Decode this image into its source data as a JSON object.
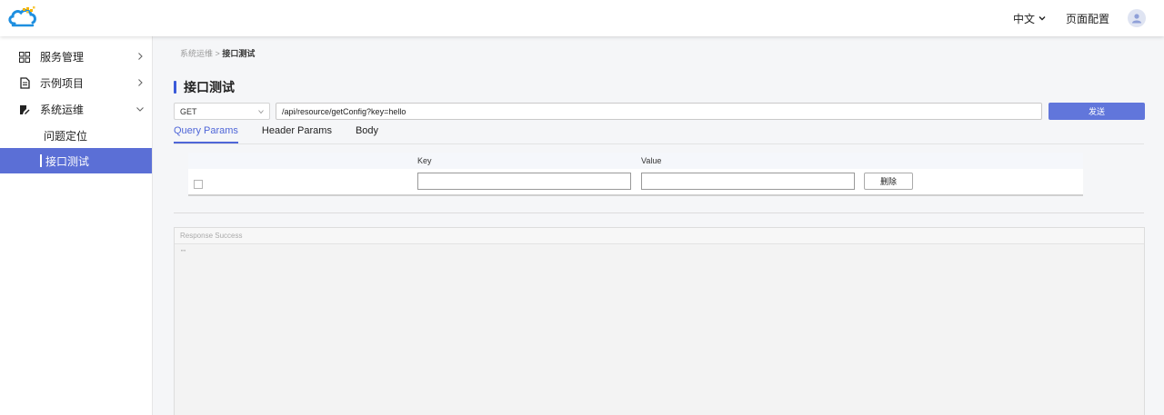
{
  "header": {
    "language": "中文",
    "page_config": "页面配置",
    "logo": "cloud-logo",
    "avatar_icon": "user-icon"
  },
  "sidebar": {
    "items": [
      {
        "label": "服务管理",
        "icon": "grid-icon",
        "arrow": "chevron-right-icon"
      },
      {
        "label": "示例项目",
        "icon": "document-icon",
        "arrow": "chevron-right-icon"
      },
      {
        "label": "系统运维",
        "icon": "edit-icon",
        "arrow": "chevron-down-icon",
        "children": [
          {
            "label": "问题定位"
          },
          {
            "label": "接口测试",
            "active": true
          }
        ]
      }
    ]
  },
  "breadcrumb": {
    "parent": "系统运维",
    "separator": ">",
    "current": "接口测试"
  },
  "page_title": "接口测试",
  "request": {
    "method": "GET",
    "url": "/api/resource/getConfig?key=hello",
    "send_label": "发送"
  },
  "tabs": [
    {
      "label": "Query Params",
      "active": true
    },
    {
      "label": "Header Params"
    },
    {
      "label": "Body"
    }
  ],
  "params_table": {
    "columns": [
      "",
      "Key",
      "Value",
      ""
    ],
    "rows": [
      {
        "key": "",
        "value": "",
        "delete_label": "删除"
      }
    ]
  },
  "response": {
    "title": "Response Success",
    "body": "\"\""
  },
  "colors": {
    "accent": "#5b6fd6",
    "send_button": "#6176db",
    "title_bar": "#3a5ad9"
  }
}
